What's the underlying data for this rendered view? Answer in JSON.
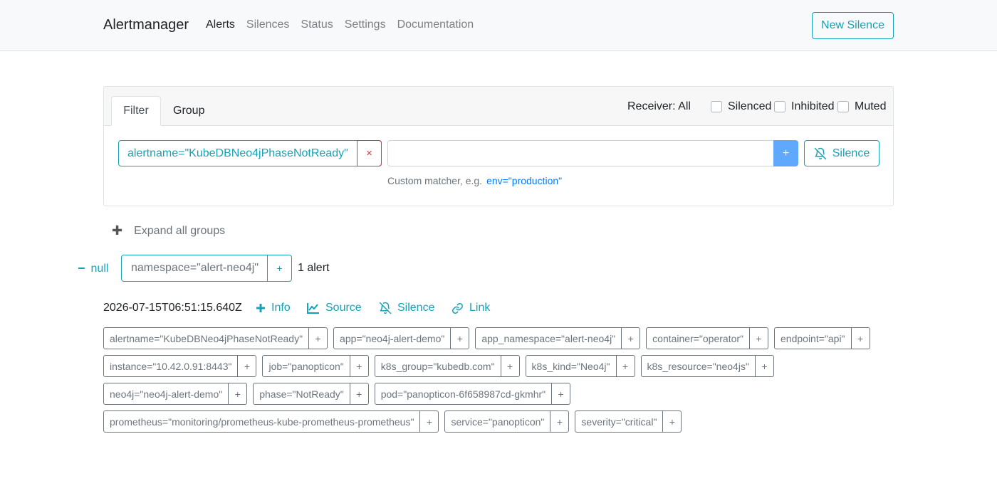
{
  "nav": {
    "brand": "Alertmanager",
    "links": [
      "Alerts",
      "Silences",
      "Status",
      "Settings",
      "Documentation"
    ],
    "new_silence": "New Silence"
  },
  "filter": {
    "tabs": [
      "Filter",
      "Group"
    ],
    "receiver": "Receiver: All",
    "checkboxes": [
      "Silenced",
      "Inhibited",
      "Muted"
    ],
    "matcher": "alertname=\"KubeDBNeo4jPhaseNotReady\"",
    "remove_icon": "×",
    "input_value": "",
    "add_label": "+",
    "silence_label": "Silence",
    "hint_text": "Custom matcher, e.g.",
    "hint_example": "env=\"production\""
  },
  "expand": {
    "icon": "✚",
    "label": "Expand all groups"
  },
  "group": {
    "toggle_icon": "−",
    "toggle_label": "null",
    "matcher": "namespace=\"alert-neo4j\"",
    "add_label": "+",
    "count": "1 alert"
  },
  "alert": {
    "timestamp": "2026-07-15T06:51:15.640Z",
    "actions": {
      "info": "Info",
      "source": "Source",
      "silence": "Silence",
      "link": "Link"
    },
    "label_rows": [
      [
        "alertname=\"KubeDBNeo4jPhaseNotReady\"",
        "app=\"neo4j-alert-demo\"",
        "app_namespace=\"alert-neo4j\"",
        "container=\"operator\"",
        "endpoint=\"api\""
      ],
      [
        "instance=\"10.42.0.91:8443\"",
        "job=\"panopticon\"",
        "k8s_group=\"kubedb.com\"",
        "k8s_kind=\"Neo4j\"",
        "k8s_resource=\"neo4js\""
      ],
      [
        "neo4j=\"neo4j-alert-demo\"",
        "phase=\"NotReady\"",
        "pod=\"panopticon-6f658987cd-gkmhr\""
      ],
      [
        "prometheus=\"monitoring/prometheus-kube-prometheus-prometheus\"",
        "service=\"panopticon\"",
        "severity=\"critical\""
      ]
    ],
    "label_add": "+"
  },
  "colors": {
    "accent": "#17a2b8",
    "danger": "#dc3545",
    "primary_add": "#5fa8fb",
    "link": "#007bff",
    "muted": "#6c757d"
  }
}
